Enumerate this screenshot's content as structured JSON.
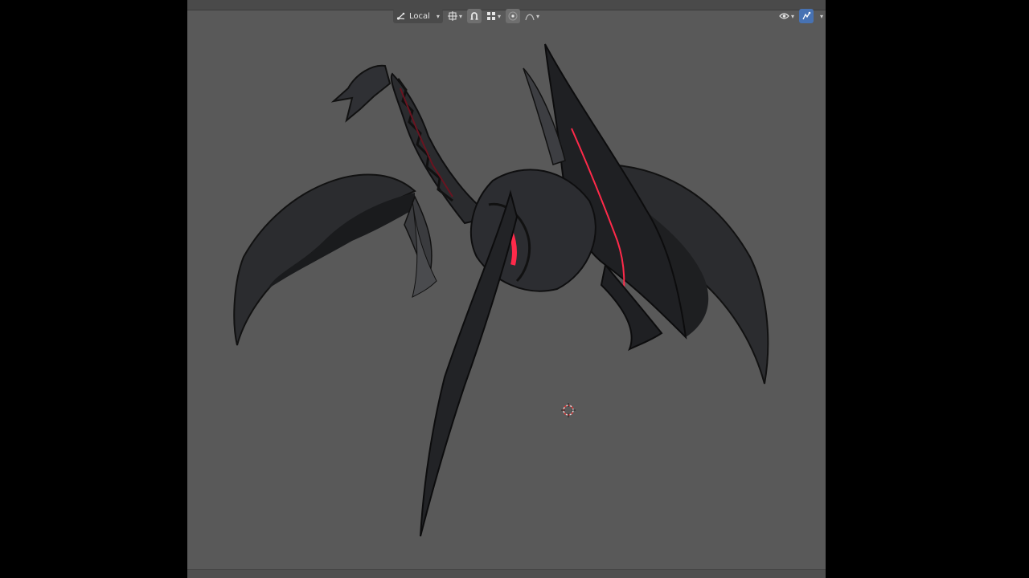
{
  "header": {
    "transform_orientation": "Local",
    "tools": {
      "orientation_icon": "transform-orientation-icon",
      "pivot_icon": "pivot-point-icon",
      "snap_icon": "snap-icon",
      "snap_target_icon": "snap-target-icon",
      "proportional_icon": "proportional-editing-icon",
      "falloff_icon": "falloff-curve-icon"
    },
    "right": {
      "visibility_icon": "selectability-visibility-icon",
      "gizmo_icon": "gizmo-icon"
    }
  },
  "viewport": {
    "background": "#595959",
    "accent": "#ff2a4a",
    "object": "dark armored dragon model"
  }
}
